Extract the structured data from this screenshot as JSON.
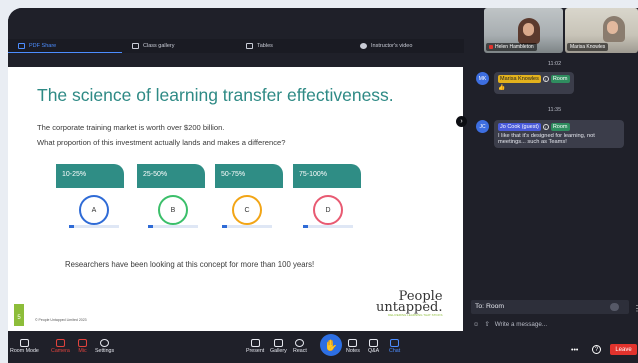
{
  "tabs": [
    {
      "label": "PDF Share",
      "active": true
    },
    {
      "label": "Class gallery",
      "active": false
    },
    {
      "label": "Tables",
      "active": false
    },
    {
      "label": "Instructor's video",
      "active": false
    }
  ],
  "videos": [
    {
      "name": "Helen Hambleton"
    },
    {
      "name": "Marisa Knowles"
    }
  ],
  "slide": {
    "title": "The science of learning transfer effectiveness.",
    "line1": "The corporate training market is worth over $200 billion.",
    "line2": "What proportion of this investment actually lands and makes a difference?",
    "options": [
      {
        "range": "10-25%",
        "letter": "A",
        "color": "#2f6bd6"
      },
      {
        "range": "25-50%",
        "letter": "B",
        "color": "#3bbf6a"
      },
      {
        "range": "50-75%",
        "letter": "C",
        "color": "#f2a516"
      },
      {
        "range": "75-100%",
        "letter": "D",
        "color": "#e85a72"
      }
    ],
    "footer": "Researchers have been looking at this concept for more than 100 years!",
    "page_number": "5",
    "copyright": "© People Untapped Limited 2023",
    "logo_line1": "People",
    "logo_line2": "untapped.",
    "logo_tag": "DELIVERING LEARNING THAT STICKS"
  },
  "chat": {
    "messages": [
      {
        "time": "11:02",
        "initials": "MK",
        "sender": "Marisa Knowles",
        "room": "Room",
        "text": "👍",
        "guest": false
      },
      {
        "time": "11:35",
        "initials": "JC",
        "sender": "Jo Cook (guest)",
        "room": "Room",
        "text": "I like that it's designed for learning, not meetings... such as Teams!",
        "guest": true
      }
    ],
    "to_label": "To: Room",
    "compose_placeholder": "Write a message..."
  },
  "toolbar": {
    "room_mode": "Room Mode",
    "camera": "Camera",
    "mic": "Mic",
    "settings": "Settings",
    "present": "Present",
    "gallery": "Gallery",
    "react": "React",
    "notes": "Notes",
    "qa": "Q&A",
    "chat": "Chat",
    "more": "•••",
    "help": "?",
    "leave": "Leave"
  },
  "colors": {
    "teal": "#2e8a85",
    "accent_blue": "#4c8dff",
    "leave_red": "#e2332d"
  }
}
